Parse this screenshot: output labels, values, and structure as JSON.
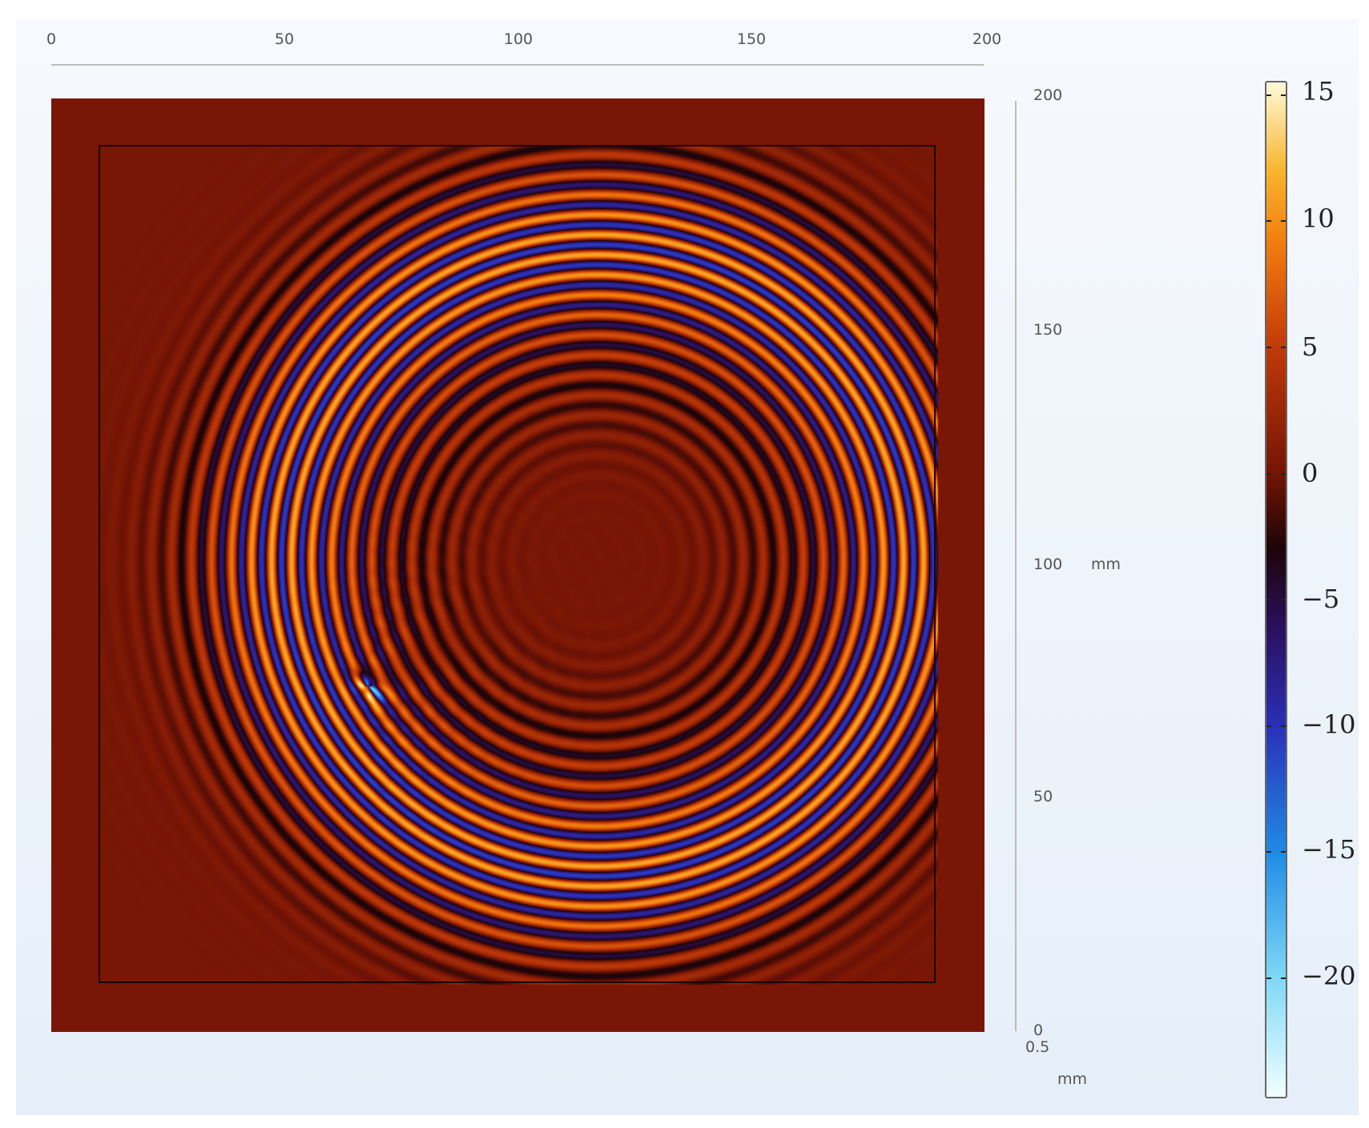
{
  "chart_data": {
    "type": "heatmap",
    "title": "",
    "x_axis": {
      "ticks": [
        "0",
        "50",
        "100",
        "150",
        "200"
      ],
      "range": [
        0,
        200
      ],
      "unit": "mm"
    },
    "y_axis": {
      "ticks": [
        "200",
        "150",
        "100",
        "50",
        "0"
      ],
      "range": [
        0,
        200
      ],
      "unit_label": "mm"
    },
    "z_axis": {
      "extra_label": "0.5",
      "unit_label": "mm"
    },
    "colorbar": {
      "ticks": [
        "15",
        "10",
        "5",
        "0",
        "−5",
        "−10",
        "−15",
        "−20"
      ],
      "tick_values": [
        15,
        10,
        5,
        0,
        -5,
        -10,
        -15,
        -20
      ],
      "range": [
        -24.7,
        15.5
      ],
      "stops": [
        {
          "v": -24.7,
          "c": "#f2ffff"
        },
        {
          "v": -20,
          "c": "#7fd8f5"
        },
        {
          "v": -15,
          "c": "#1f8be6"
        },
        {
          "v": -10,
          "c": "#2a2fb8"
        },
        {
          "v": -6,
          "c": "#2a0f5a"
        },
        {
          "v": -3,
          "c": "#1c0508"
        },
        {
          "v": 0,
          "c": "#741405"
        },
        {
          "v": 5,
          "c": "#c23a08"
        },
        {
          "v": 9,
          "c": "#f27a0e"
        },
        {
          "v": 12,
          "c": "#f8b52e"
        },
        {
          "v": 15.5,
          "c": "#fffad8"
        }
      ]
    },
    "field": {
      "wave_center_mm": [
        117,
        101
      ],
      "peak_radius_mm": 68,
      "envelope_width_mm": 14,
      "wavelength_mm": 4.3,
      "amplitude": 11,
      "defect_location_mm": [
        68,
        74
      ],
      "background_value": 0.3
    }
  }
}
